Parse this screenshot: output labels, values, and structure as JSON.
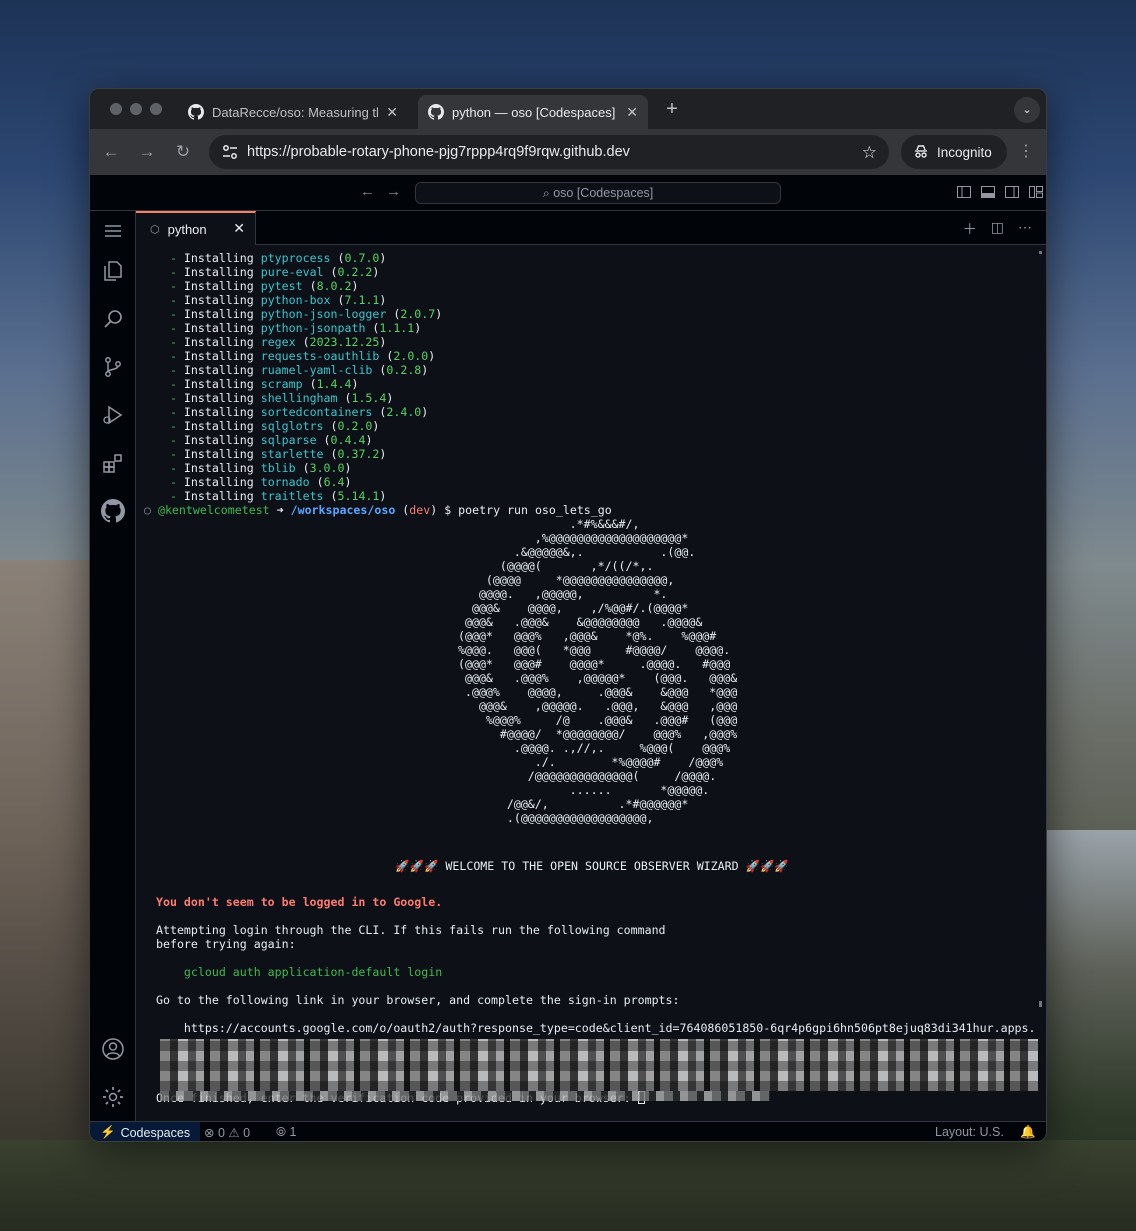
{
  "browser": {
    "tabs": [
      {
        "title": "DataRecce/oso: Measuring th",
        "active": false
      },
      {
        "title": "python — oso [Codespaces] -",
        "active": true
      }
    ],
    "url": "https://probable-rotary-phone-pjg7rppp4rq9f9rqw.github.dev",
    "incognito_label": "Incognito"
  },
  "vscode": {
    "command_center": "oso [Codespaces]",
    "editor_tab": "python",
    "status": {
      "remote": "Codespaces",
      "errors": "0",
      "warnings": "0",
      "ports": "1",
      "layout": "Layout: U.S."
    }
  },
  "terminal": {
    "installs": [
      {
        "name": "ptyprocess",
        "version": "0.7.0"
      },
      {
        "name": "pure-eval",
        "version": "0.2.2"
      },
      {
        "name": "pytest",
        "version": "8.0.2"
      },
      {
        "name": "python-box",
        "version": "7.1.1"
      },
      {
        "name": "python-json-logger",
        "version": "2.0.7"
      },
      {
        "name": "python-jsonpath",
        "version": "1.1.1"
      },
      {
        "name": "regex",
        "version": "2023.12.25"
      },
      {
        "name": "requests-oauthlib",
        "version": "2.0.0"
      },
      {
        "name": "ruamel-yaml-clib",
        "version": "0.2.8"
      },
      {
        "name": "scramp",
        "version": "1.4.4"
      },
      {
        "name": "shellingham",
        "version": "1.5.4"
      },
      {
        "name": "sortedcontainers",
        "version": "2.4.0"
      },
      {
        "name": "sqlglotrs",
        "version": "0.2.0"
      },
      {
        "name": "sqlparse",
        "version": "0.4.4"
      },
      {
        "name": "starlette",
        "version": "0.37.2"
      },
      {
        "name": "tblib",
        "version": "3.0.0"
      },
      {
        "name": "tornado",
        "version": "6.4"
      },
      {
        "name": "traitlets",
        "version": "5.14.1"
      }
    ],
    "install_prefix": "Installing",
    "prompt_user": "@kentwelcometest",
    "prompt_arrow": "➜",
    "prompt_path": "/workspaces/oso",
    "prompt_branch": "dev",
    "prompt_command": "$ poetry run oso_lets_go",
    "ascii_art": "                .*#%&&&#/,\n           ,%@@@@@@@@@@@@@@@@@@@*\n        .&@@@@@&,.           .(@@.\n      (@@@@(       ,*/((/*,.\n    (@@@@     *@@@@@@@@@@@@@@@,\n   @@@@.   ,@@@@@,          *.\n  @@@&    @@@@,    ,/%@@#/.(@@@@*\n @@@&   .@@@&    &@@@@@@@@   .@@@@&\n(@@@*   @@@%   ,@@@&    *@%.    %@@@#\n%@@@.   @@@(   *@@@     #@@@@/    @@@@.\n(@@@*   @@@#    @@@@*     .@@@@.   #@@@\n @@@&   .@@@%    ,@@@@@*    (@@@.   @@@&\n .@@@%    @@@@,     .@@@&    &@@@   *@@@\n   @@@&    ,@@@@@.   .@@@,   &@@@   ,@@@\n    %@@@%     /@    .@@@&   .@@@#   (@@@\n      #@@@@/  *@@@@@@@@/    @@@%   ,@@@%\n        .@@@@. .,//,.     %@@@(    @@@%\n           ./.        *%@@@@#    /@@@%\n          /@@@@@@@@@@@@@@(     /@@@@.\n                ......       *@@@@@.\n       /@@&/,          .*#@@@@@@*\n       .(@@@@@@@@@@@@@@@@@@,",
    "welcome": "🚀🚀🚀 WELCOME TO THE OPEN SOURCE OBSERVER WIZARD 🚀🚀🚀",
    "not_logged_in": "You don't seem to be logged in to Google.",
    "attempt_1": "Attempting login through the CLI. If this fails run the following command",
    "attempt_2": "before trying again:",
    "gcloud_cmd": "    gcloud auth application-default login",
    "go_to_link": "Go to the following link in your browser, and complete the sign-in prompts:",
    "auth_url": "    https://accounts.google.com/o/oauth2/auth?response_type=code&client_id=764086051850-6qr4p6gpi6hn506pt8ejuq83di341hur.apps.",
    "finished": "Once finished, enter the verification code provided in your browser: "
  }
}
